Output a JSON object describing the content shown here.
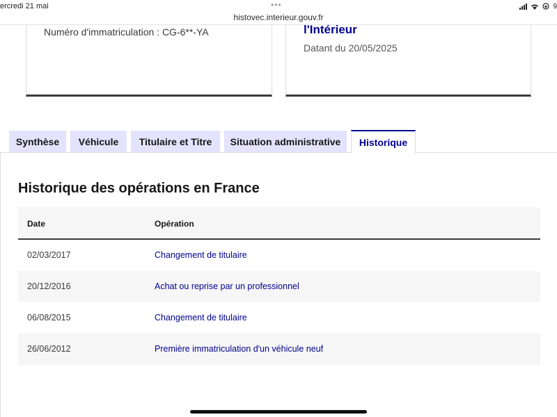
{
  "status_bar": {
    "time": "ercredi 21 mai",
    "dots": "•••",
    "url": "histovec.interieur.gouv.fr",
    "battery": "9"
  },
  "cards": {
    "left": {
      "registration": "Numéro d'immatriculation : CG-6**-YA"
    },
    "right": {
      "title": "l'Intérieur",
      "date": "Datant du 20/05/2025"
    }
  },
  "tabs": [
    {
      "label": "Synthèse",
      "active": false
    },
    {
      "label": "Véhicule",
      "active": false
    },
    {
      "label": "Titulaire et Titre",
      "active": false
    },
    {
      "label": "Situation administrative",
      "active": false
    },
    {
      "label": "Historique",
      "active": true
    }
  ],
  "history": {
    "title": "Historique des opérations en France",
    "columns": {
      "date": "Date",
      "operation": "Opération"
    },
    "rows": [
      {
        "date": "02/03/2017",
        "operation": "Changement de titulaire"
      },
      {
        "date": "20/12/2016",
        "operation": "Achat ou reprise par un professionnel"
      },
      {
        "date": "06/08/2015",
        "operation": "Changement de titulaire"
      },
      {
        "date": "26/06/2012",
        "operation": "Première immatriculation d'un véhicule neuf"
      }
    ]
  },
  "colors": {
    "accent": "#000091",
    "tab_background": "#e3e3fd",
    "row_alt": "#f6f6f6"
  }
}
